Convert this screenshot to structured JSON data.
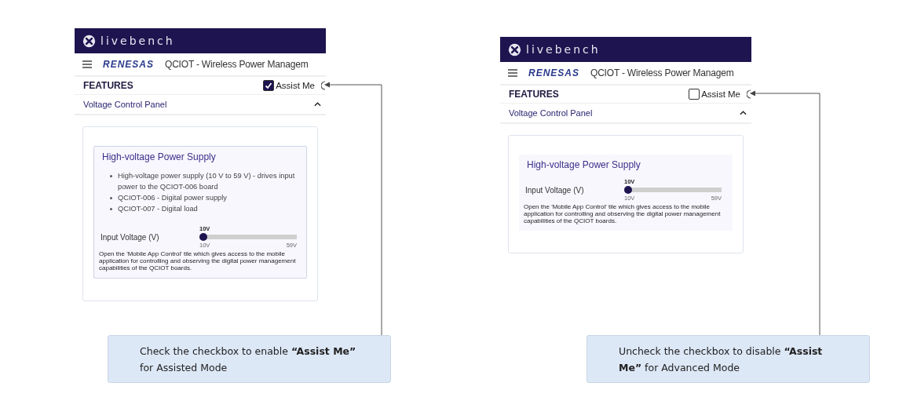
{
  "examples": [
    {
      "screen": {
        "brand": "livebench",
        "vendor_logo": "RENESAS",
        "title": "QCIOT - Wireless Power Managem",
        "section": "FEATURES",
        "assist": {
          "label": "Assist Me",
          "checked": true
        },
        "panel": {
          "title": "Voltage Control Panel",
          "expanded": true
        },
        "card": {
          "title": "High-voltage Power Supply",
          "bullets": [
            "High-voltage power supply (10 V to 59 V) - drives input power to the QCIOT-006 board",
            "QCIOT-006 - Digital power supply",
            "QCIOT-007 - Digital load"
          ],
          "slider": {
            "label": "Input Voltage (V)",
            "value_label": "10V",
            "level": 0,
            "min_label": "10V",
            "max_label": "59V"
          },
          "note": "Open the 'Mobile App Control' tile which gives access to the mobile application for controlling and observing the digital power management capabilities of the QCIOT boards."
        }
      },
      "callout": "Check the checkbox to enable **“Assist Me”** for Assisted Mode"
    },
    {
      "screen": {
        "brand": "livebench",
        "vendor_logo": "RENESAS",
        "title": "QCIOT - Wireless Power Managem",
        "section": "FEATURES",
        "assist": {
          "label": "Assist Me",
          "checked": false
        },
        "panel": {
          "title": "Voltage Control Panel",
          "expanded": true
        },
        "card": {
          "title": "High-voltage Power Supply",
          "slider": {
            "label": "Input Voltage (V)",
            "value_label": "10V",
            "level": 0,
            "min_label": "10V",
            "max_label": "59V"
          },
          "note": "Open the 'Mobile App Control' tile which gives access to the mobile application for controlling and observing the digital power management capabilities of the QCIOT boards."
        }
      },
      "callout": "Uncheck the checkbox to disable **“Assist Me”** for Advanced  Mode"
    }
  ]
}
